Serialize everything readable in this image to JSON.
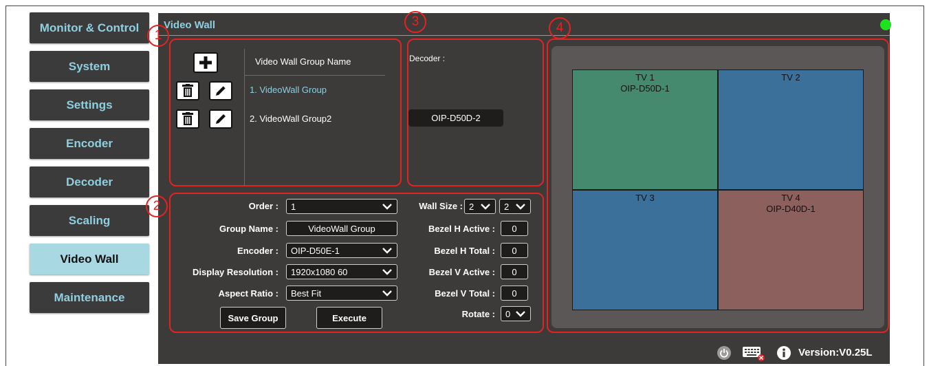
{
  "sidebar": {
    "items": [
      {
        "label": "Monitor & Control"
      },
      {
        "label": "System"
      },
      {
        "label": "Settings"
      },
      {
        "label": "Encoder"
      },
      {
        "label": "Decoder"
      },
      {
        "label": "Scaling"
      },
      {
        "label": "Video Wall",
        "active": true
      },
      {
        "label": "Maintenance"
      }
    ]
  },
  "panel": {
    "title": "Video Wall",
    "status_color": "#1fe21f"
  },
  "callouts": [
    "1",
    "2",
    "3",
    "4"
  ],
  "groups": {
    "header": "Video Wall Group Name",
    "add_icon": "plus-icon",
    "items": [
      {
        "name": "1. VideoWall Group",
        "selected": true
      },
      {
        "name": "2. VideoWall Group2",
        "selected": false
      }
    ]
  },
  "decoder_panel": {
    "label": "Decoder :",
    "chip": "OIP-D50D-2"
  },
  "form": {
    "order_label": "Order :",
    "order_value": "1",
    "group_name_label": "Group Name :",
    "group_name_value": "VideoWall Group",
    "encoder_label": "Encoder :",
    "encoder_value": "OIP-D50E-1",
    "display_resolution_label": "Display Resolution :",
    "display_resolution_value": "1920x1080 60",
    "aspect_ratio_label": "Aspect Ratio :",
    "aspect_ratio_value": "Best Fit",
    "save_group": "Save Group",
    "execute": "Execute",
    "wall_size_label": "Wall Size :",
    "wall_size_cols": "2",
    "wall_size_rows": "2",
    "bezel_h_active_label": "Bezel H Active :",
    "bezel_h_active_value": "0",
    "bezel_h_total_label": "Bezel H Total :",
    "bezel_h_total_value": "0",
    "bezel_v_active_label": "Bezel V Active :",
    "bezel_v_active_value": "0",
    "bezel_v_total_label": "Bezel V Total :",
    "bezel_v_total_value": "0",
    "rotate_label": "Rotate :",
    "rotate_value": "0"
  },
  "wall": {
    "tiles": [
      {
        "name": "TV 1",
        "decoder": "OIP-D50D-1",
        "color": "#458a6f"
      },
      {
        "name": "TV 2",
        "decoder": "",
        "color": "#3a7099"
      },
      {
        "name": "TV 3",
        "decoder": "",
        "color": "#3a7099"
      },
      {
        "name": "TV 4",
        "decoder": "OIP-D40D-1",
        "color": "#8c605c"
      }
    ]
  },
  "footer": {
    "power_icon": "power-icon",
    "keyboard_icon": "keyboard-icon",
    "info_icon": "info-icon",
    "version": "Version:V0.25L"
  }
}
